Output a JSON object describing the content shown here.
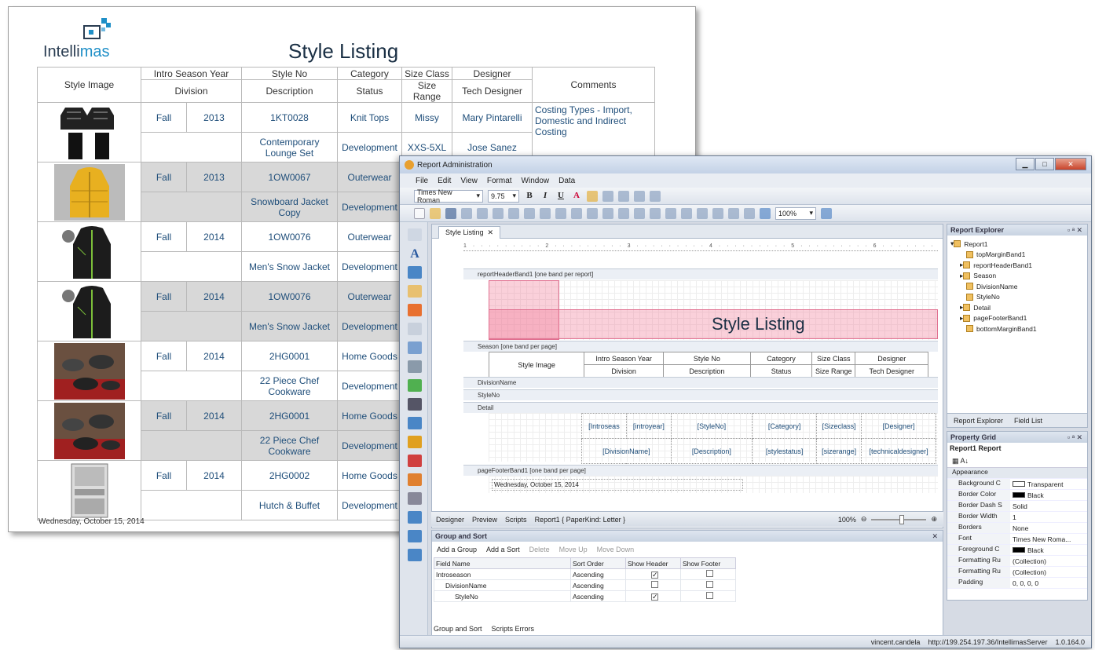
{
  "report": {
    "logo_text_a": "Intelli",
    "logo_text_b": "mas",
    "title": "Style Listing",
    "headers": {
      "style_image": "Style Image",
      "intro_season_year": "Intro Season Year",
      "division": "Division",
      "style_no": "Style No",
      "description": "Description",
      "category": "Category",
      "status": "Status",
      "size_class": "Size Class",
      "size_range": "Size Range",
      "designer": "Designer",
      "tech_designer": "Tech Designer",
      "comments": "Comments"
    },
    "rows": [
      {
        "season": "Fall",
        "year": "2013",
        "style": "1KT0028",
        "category": "Knit Tops",
        "size_class": "Missy",
        "designer": "Mary  Pintarelli",
        "comment": "Costing Types - Import, Domestic and Indirect Costing",
        "description": "Contemporary Lounge Set",
        "status": "Development",
        "size_range": "XXS-5XL",
        "tech_designer": "Jose  Sanez",
        "image": "knit-set-image"
      },
      {
        "season": "Fall",
        "year": "2013",
        "style": "1OW0067",
        "category": "Outerwear",
        "size_class": "",
        "designer": "",
        "comment": "",
        "description": "Snowboard Jacket Copy",
        "status": "Development",
        "size_range": "",
        "tech_designer": "",
        "image": "yellow-jacket-image"
      },
      {
        "season": "Fall",
        "year": "2014",
        "style": "1OW0076",
        "category": "Outerwear",
        "size_class": "",
        "designer": "",
        "comment": "",
        "description": "Men's Snow Jacket",
        "status": "Development",
        "size_range": "",
        "tech_designer": "",
        "image": "black-jacket-image"
      },
      {
        "season": "Fall",
        "year": "2014",
        "style": "1OW0076",
        "category": "Outerwear",
        "size_class": "",
        "designer": "",
        "comment": "",
        "description": "Men's Snow Jacket",
        "status": "Development",
        "size_range": "",
        "tech_designer": "",
        "image": "black-jacket-image"
      },
      {
        "season": "Fall",
        "year": "2014",
        "style": "2HG0001",
        "category": "Home Goods",
        "size_class": "",
        "designer": "",
        "comment": "",
        "description": "22 Piece Chef Cookware",
        "status": "Development",
        "size_range": "",
        "tech_designer": "",
        "image": "cookware-image"
      },
      {
        "season": "Fall",
        "year": "2014",
        "style": "2HG0001",
        "category": "Home Goods",
        "size_class": "",
        "designer": "",
        "comment": "",
        "description": "22 Piece Chef Cookware",
        "status": "Development",
        "size_range": "",
        "tech_designer": "",
        "image": "cookware-image"
      },
      {
        "season": "Fall",
        "year": "2014",
        "style": "2HG0002",
        "category": "Home Goods",
        "size_class": "",
        "designer": "",
        "comment": "",
        "description": "Hutch & Buffet",
        "status": "Development",
        "size_range": "",
        "tech_designer": "",
        "image": "hutch-image"
      }
    ],
    "footer_date": "Wednesday, October 15, 2014"
  },
  "app": {
    "title": "Report Administration",
    "menu": [
      "File",
      "Edit",
      "View",
      "Format",
      "Window",
      "Data"
    ],
    "font_name": "Times New Roman",
    "font_size": "9.75",
    "zoom": "100%",
    "doc_tab": "Style Listing",
    "ruler_marks": "1 · · · · · · · · · 2 · · · · · · · · · 3 · · · · · · · · · 4 · · · · · · · · · 5 · · · · · · · · · 6 · · · · · · · · · 7",
    "bands": {
      "report_header": "reportHeaderBand1 [one band per report]",
      "season": "Season [one band per page]",
      "division": "DivisionName",
      "styleno": "StyleNo",
      "detail": "Detail",
      "page_footer": "pageFooterBand1 [one band per page]"
    },
    "designer_title": "Style Listing",
    "design_header": {
      "style_image": "Style Image",
      "intro": "Intro Season Year",
      "division": "Division",
      "style_no": "Style No",
      "description": "Description",
      "category": "Category",
      "status": "Status",
      "size_class": "Size Class",
      "size_range": "Size Range",
      "designer": "Designer",
      "tech": "Tech Designer"
    },
    "detail_fields": {
      "introseas": "[Introseas",
      "introyear": "[introyear]",
      "styleno": "[StyleNo]",
      "category": "[Category]",
      "sizeclass": "[Sizeclass]",
      "designer": "[Designer]",
      "division": "[DivisionName]",
      "description": "[Description]",
      "stylestatus": "[stylestatus]",
      "sizerange": "[sizerange]",
      "techdesigner": "[technicaldesigner]"
    },
    "footer_date": "Wednesday, October 15, 2014",
    "status_tabs": {
      "designer": "Designer",
      "preview": "Preview",
      "scripts": "Scripts",
      "info": "Report1 { PaperKind: Letter }"
    },
    "zoom_status": "100%",
    "group_sort": {
      "title": "Group and Sort",
      "add_group": "Add a Group",
      "add_sort": "Add a Sort",
      "delete": "Delete",
      "move_up": "Move Up",
      "move_down": "Move Down",
      "columns": [
        "Field Name",
        "Sort Order",
        "Show Header",
        "Show Footer"
      ],
      "rows": [
        {
          "field": "Introseason",
          "order": "Ascending",
          "header": "✓",
          "footer": ""
        },
        {
          "field": "DivisionName",
          "order": "Ascending",
          "header": "",
          "footer": ""
        },
        {
          "field": "StyleNo",
          "order": "Ascending",
          "header": "✓",
          "footer": ""
        }
      ],
      "tab1": "Group and Sort",
      "tab2": "Scripts Errors"
    },
    "explorer": {
      "title": "Report Explorer",
      "nodes": [
        "Report1",
        "topMarginBand1",
        "reportHeaderBand1",
        "Season",
        "DivisionName",
        "StyleNo",
        "Detail",
        "pageFooterBand1",
        "bottomMarginBand1"
      ],
      "tab1": "Report Explorer",
      "tab2": "Field List"
    },
    "property_grid": {
      "title": "Property Grid",
      "selected": "Report1  Report",
      "category": "Appearance",
      "rows": [
        {
          "k": "Background C",
          "v": "Transparent",
          "swatch": "#ffffff"
        },
        {
          "k": "Border Color",
          "v": "Black",
          "swatch": "#000000"
        },
        {
          "k": "Border Dash S",
          "v": "Solid"
        },
        {
          "k": "Border Width",
          "v": "1"
        },
        {
          "k": "Borders",
          "v": "None"
        },
        {
          "k": "Font",
          "v": "Times New Roma..."
        },
        {
          "k": "Foreground C",
          "v": "Black",
          "swatch": "#000000"
        },
        {
          "k": "Formatting Ru",
          "v": "(Collection)"
        },
        {
          "k": "Formatting Ru",
          "v": "(Collection)"
        },
        {
          "k": "Padding",
          "v": "0, 0, 0, 0"
        }
      ]
    },
    "status": {
      "user": "vincent.candela",
      "server": "http://199.254.197.36/IntellimasServer",
      "version": "1.0.164.0"
    }
  }
}
